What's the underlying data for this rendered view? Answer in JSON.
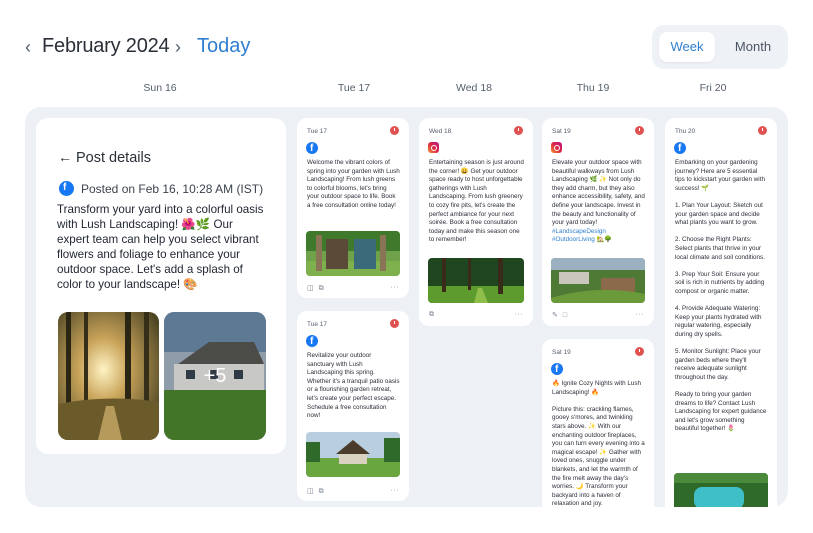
{
  "header": {
    "month": "February 2024",
    "today": "Today",
    "prev_icon": "chevron-left-icon",
    "next_icon": "chevron-right-icon",
    "views": [
      "Week",
      "Month"
    ],
    "active_view": "Week"
  },
  "days": [
    "Sun 16",
    "Tue 17",
    "Wed 18",
    "Thu 19",
    "Fri 20"
  ],
  "details": {
    "back_icon": "arrow-left-icon",
    "title": "Post details",
    "posted": "Posted on Feb 16, 10:28 AM (IST)",
    "body": "Transform your yard into a colorful oasis with Lush Landscaping! 🌺🌿 Our expert team can help you select vibrant flowers and foliage to enhance your outdoor space. Let's add a splash of color to your landscape! 🎨",
    "more_photos": "+5"
  },
  "posts": {
    "tue_a": {
      "date": "Tue 17",
      "network": "facebook",
      "text": "Welcome the vibrant colors of spring into your garden with Lush Landscaping! From lush greens to colorful blooms, let's bring your outdoor space to life. Book a free consultation online today!"
    },
    "tue_b": {
      "date": "Tue 17",
      "network": "facebook",
      "text": "Revitalize your outdoor sanctuary with Lush Landscaping this spring. Whether it's a tranquil patio oasis or a flourishing garden retreat, let's create your perfect escape. Schedule a free consultation now!"
    },
    "wed": {
      "date": "Wed 18",
      "network": "instagram",
      "text": "Entertaining season is just around the corner! 😀 Get your outdoor space ready to host unforgettable gatherings with Lush Landscaping. From lush greenery to cozy fire pits, let's create the perfect ambiance for your next soirée. Book a free consultation today and make this season one to remember!"
    },
    "sat_a": {
      "date": "Sat 19",
      "network": "instagram",
      "text": "Elevate your outdoor space with beautiful walkways from Lush Landscaping 🌿 ✨ Not only do they add charm, but they also enhance accessibility, safety, and define your landscape. Invest in the beauty and functionality of your yard today!",
      "tags": "#LandscapeDesign #OutdoorLiving 🏡🌳"
    },
    "sat_b": {
      "date": "Sat 19",
      "network": "facebook",
      "heading": "🔥 Ignite Cozy Nights with Lush Landscaping! 🔥",
      "text": "Picture this: crackling flames, gooey s'mores, and twinkling stars above. ✨ With our enchanting outdoor fireplaces, you can turn every evening into a magical escape! ✨ Gather with loved ones, snuggle under blankets, and let the warmth of the fire melt away the day's worries. 🌙 Transform your backyard into a haven of relaxation and joy."
    },
    "thu": {
      "date": "Thu 20",
      "network": "facebook",
      "paragraphs": [
        "Embarking on your gardening journey? Here are 5 essential tips to kickstart your garden with success! 🌱",
        "1. Plan Your Layout: Sketch out your garden space and decide what plants you want to grow.",
        "2. Choose the Right Plants: Select plants that thrive in your local climate and soil conditions.",
        "3. Prep Your Soil: Ensure your soil is rich in nutrients by adding compost or organic matter.",
        "4. Provide Adequate Watering: Keep your plants hydrated with regular watering, especially during dry spells.",
        "5. Monitor Sunlight: Place your garden beds where they'll receive adequate sunlight throughout the day.",
        "Ready to bring your garden dreams to life? Contact Lush Landscaping for expert guidance and let's grow something beautiful together! 🌷"
      ]
    }
  },
  "footer_icons": [
    "trash-icon",
    "copy-icon",
    "more-icon"
  ],
  "more_label": "···",
  "colors": {
    "accent": "#2f7fcf",
    "board": "#edf0f5",
    "badge": "#e05252",
    "facebook": "#1877f2"
  }
}
